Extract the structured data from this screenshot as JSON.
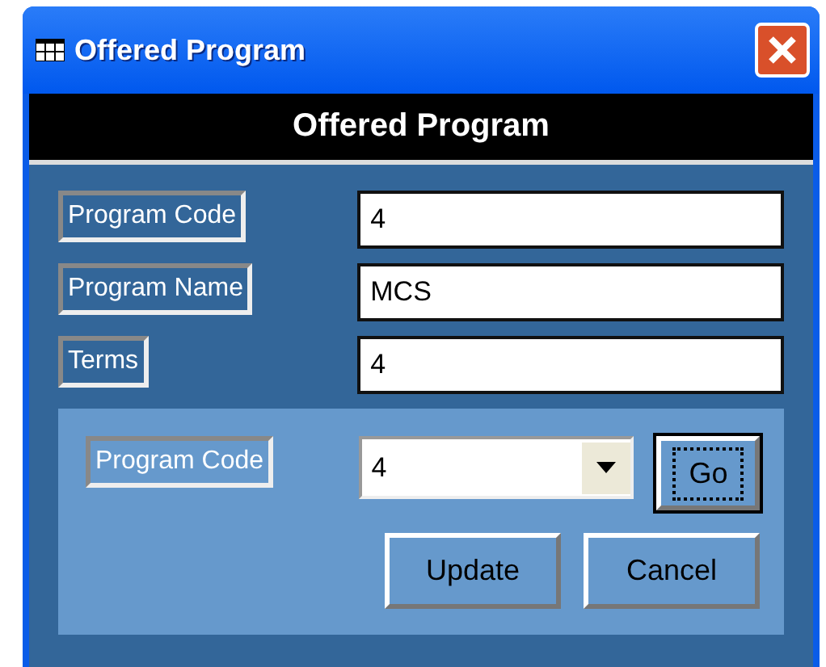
{
  "window": {
    "title": "Offered Program"
  },
  "header": "Offered Program",
  "fields": [
    {
      "label": "Program Code",
      "value": "4"
    },
    {
      "label": "Program Name",
      "value": "MCS"
    },
    {
      "label": "Terms",
      "value": "4"
    }
  ],
  "lookup": {
    "label": "Program Code",
    "value": "4",
    "go_button": {
      "label": "Go",
      "focused": true
    }
  },
  "buttons": [
    "Update",
    "Cancel"
  ]
}
